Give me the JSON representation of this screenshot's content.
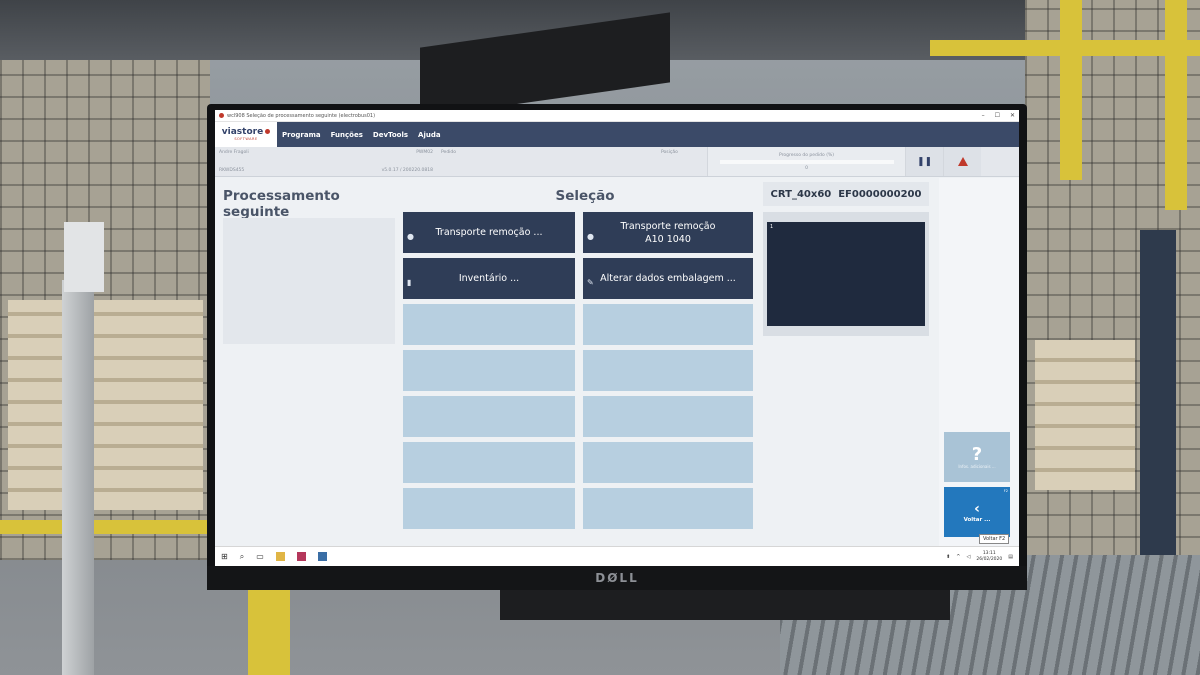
{
  "window": {
    "title": "wcl908 Seleção de processamento seguinte (electrobus01)",
    "controls": [
      "–",
      "☐",
      "✕"
    ]
  },
  "brand": {
    "name": "viastore",
    "sub": "SOFTWARE",
    "accent": "#c0392b"
  },
  "menu": [
    "Programa",
    "Funções",
    "DevTools",
    "Ajuda"
  ],
  "info": {
    "user": "Andre Fragoli",
    "station": "PWM02",
    "order_label": "Pedido",
    "workstation": "RKWDS455",
    "version": "v5.0.17 / 200220.0818",
    "position_label": "Posição",
    "progress_label": "Progresso do pedido (%)",
    "progress_value": "0",
    "progress_fraction": 0
  },
  "main": {
    "left_title": "Processamento seguinte",
    "selection_title": "Seleção",
    "tiles": [
      {
        "label": "Transporte remoção ...",
        "icon": "●"
      },
      {
        "label": "Transporte remoção\nA10 1040",
        "icon": "●"
      },
      {
        "label": "Inventário ...",
        "icon": "▮"
      },
      {
        "label": "Alterar dados embalagem ...",
        "icon": "✎"
      }
    ],
    "crt_header": "CRT_40x60  EF0000000200",
    "crt_content": "1"
  },
  "side": {
    "help_glyph": "?",
    "help_label": "Infos. adicionais ...",
    "back_glyph": "‹",
    "back_label": "Voltar ...",
    "back_key": "F2",
    "tooltip": "Voltar F2"
  },
  "taskbar": {
    "time": "13:11",
    "date": "26/02/2020",
    "icons": [
      "windows-icon",
      "search-icon",
      "task-view-icon",
      "file-explorer-icon",
      "app-icon",
      "viastore-app-icon"
    ]
  },
  "monitor_brand": "DØLL",
  "colors": {
    "menubar": "#3b4a68",
    "tile_dark": "#2f3d57",
    "tile_empty": "#b7cfe0",
    "back_button": "#2378bd"
  }
}
